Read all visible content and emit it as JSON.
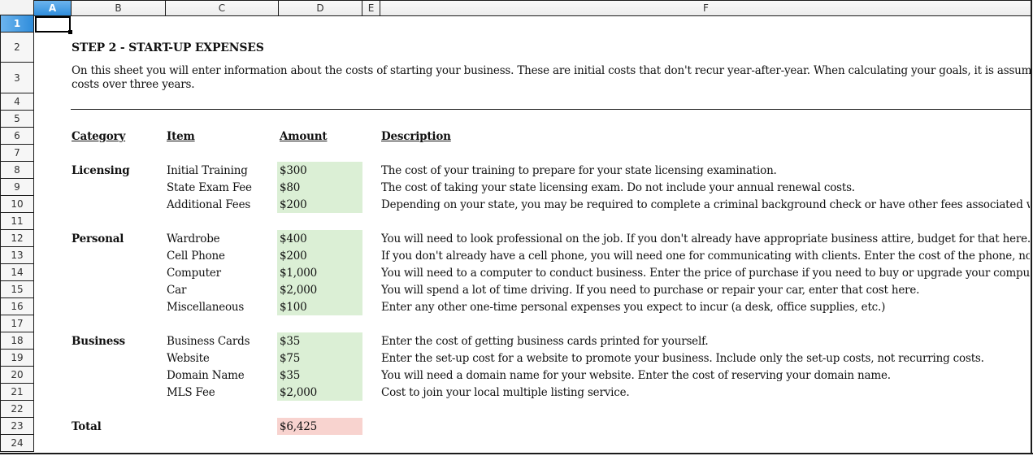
{
  "spreadsheet": {
    "columns": [
      {
        "label": "A",
        "selected": true
      },
      {
        "label": "B",
        "selected": false
      },
      {
        "label": "C",
        "selected": false
      },
      {
        "label": "D",
        "selected": false
      },
      {
        "label": "E",
        "selected": false
      },
      {
        "label": "F",
        "selected": false
      }
    ],
    "rows": [
      "1",
      "2",
      "3",
      "4",
      "5",
      "6",
      "7",
      "8",
      "9",
      "10",
      "11",
      "12",
      "13",
      "14",
      "15",
      "16",
      "17",
      "18",
      "19",
      "20",
      "21",
      "22",
      "23",
      "24"
    ],
    "selected_cell": "A1",
    "colors": {
      "selection_accent": "#2f8ddb",
      "input_fill": "#dbefd5",
      "total_fill": "#f8d3cf"
    }
  },
  "content": {
    "title": "STEP 2 - START-UP EXPENSES",
    "intro_line1": "On this sheet you will enter information about the costs of starting your business. These are initial costs that don't recur year-after-year. When calculating your goals, it is assumed you will re",
    "intro_line2": "costs over three years.",
    "headers": {
      "category": "Category",
      "item": "Item",
      "amount": "Amount",
      "description": "Description"
    },
    "groups": [
      {
        "category": "Licensing",
        "items": [
          {
            "item": "Initial Training",
            "amount": "$300",
            "description": "The cost of your training to prepare for your state licensing examination."
          },
          {
            "item": "State Exam Fee",
            "amount": "$80",
            "description": "The cost of taking your state licensing exam.  Do not include your annual renewal costs."
          },
          {
            "item": "Additional Fees",
            "amount": "$200",
            "description": "Depending on your state, you may be required to complete a criminal background check or have other fees associated with being"
          }
        ]
      },
      {
        "category": "Personal",
        "items": [
          {
            "item": "Wardrobe",
            "amount": "$400",
            "description": "You will need to look professional on the job. If you don't already have appropriate business attire, budget for that here."
          },
          {
            "item": "Cell Phone",
            "amount": "$200",
            "description": "If you don't already have a cell phone, you will need one for communicating with clients.  Enter the cost of the phone, not your mo"
          },
          {
            "item": "Computer",
            "amount": "$1,000",
            "description": "You will need to a computer to conduct business. Enter the price of purchase if you need to buy or upgrade your computer."
          },
          {
            "item": "Car",
            "amount": "$2,000",
            "description": "You will spend a lot of time driving. If you need to purchase or repair your car, enter that cost here."
          },
          {
            "item": "Miscellaneous",
            "amount": "$100",
            "description": "Enter any other one-time personal expenses you expect to incur (a desk, office supplies, etc.)"
          }
        ]
      },
      {
        "category": "Business",
        "items": [
          {
            "item": "Business Cards",
            "amount": "$35",
            "description": "Enter the cost of getting business cards printed for yourself."
          },
          {
            "item": "Website",
            "amount": "$75",
            "description": "Enter the set-up cost for a website to promote your business. Include only  the set-up costs, not recurring costs."
          },
          {
            "item": "Domain Name",
            "amount": "$35",
            "description": "You will need a domain name for your website. Enter the cost of reserving your domain name."
          },
          {
            "item": "MLS Fee",
            "amount": "$2,000",
            "description": "Cost to join your local multiple listing service."
          }
        ]
      }
    ],
    "total": {
      "label": "Total",
      "amount": "$6,425"
    }
  }
}
